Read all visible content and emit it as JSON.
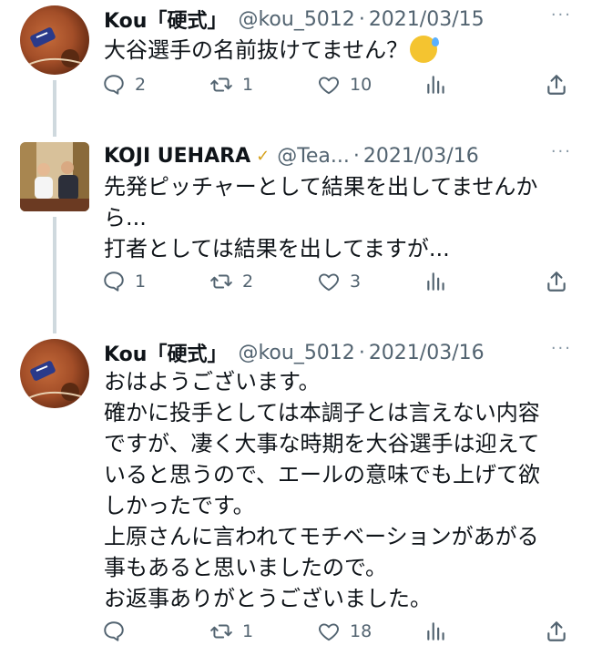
{
  "tweets": [
    {
      "name": "Kou「硬式」",
      "handle": "@kou_5012",
      "date": "2021/03/15",
      "lines": [
        "大谷選手の名前抜けてません？"
      ],
      "reply_count": "2",
      "retweet_count": "1",
      "like_count": "10"
    },
    {
      "name": "KOJI UEHARA",
      "verified_icon": "verified-badge-icon",
      "handle": "@Tea...",
      "date": "2021/03/16",
      "lines": [
        "先発ピッチャーとして結果を出してませんか",
        "ら...",
        "打者としては結果を出してますが..."
      ],
      "reply_count": "1",
      "retweet_count": "2",
      "like_count": "3"
    },
    {
      "name": "Kou「硬式」",
      "handle": "@kou_5012",
      "date": "2021/03/16",
      "lines": [
        "おはようございます。",
        "確かに投手としては本調子とは言えない内容",
        "ですが、凄く大事な時期を大谷選手は迎えて",
        "いると思うので、エールの意味でも上げて欲",
        "しかったです。",
        "上原さんに言われてモチベーションがあがる",
        "事もあると思いましたので。",
        "お返事ありがとうございました。"
      ],
      "reply_count": "",
      "retweet_count": "1",
      "like_count": "18"
    }
  ],
  "separator": "·",
  "more_glyph": "···",
  "colors": {
    "text": "#0f1419",
    "secondary": "#536471",
    "thread_line": "#cfd9de",
    "verified": "#d6a21e"
  },
  "icons": [
    "reply-icon",
    "retweet-icon",
    "like-icon",
    "analytics-icon",
    "share-icon",
    "more-icon",
    "sweat-smile-emoji-icon"
  ]
}
